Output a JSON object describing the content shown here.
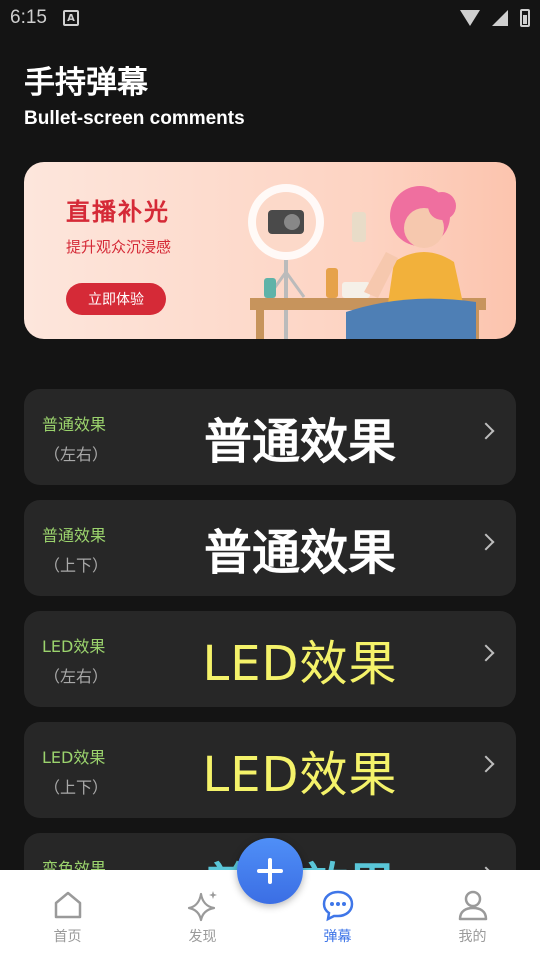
{
  "status_bar": {
    "time": "6:15"
  },
  "header": {
    "title": "手持弹幕",
    "subtitle": "Bullet-screen comments"
  },
  "banner": {
    "title": "直播补光",
    "subtitle": "提升观众沉浸感",
    "button": "立即体验"
  },
  "cards": [
    {
      "label": "普通效果",
      "sublabel": "（左右）",
      "preview": "普通效果"
    },
    {
      "label": "普通效果",
      "sublabel": "（上下）",
      "preview": "普通效果"
    },
    {
      "label": "LED效果",
      "sublabel": "（左右）",
      "preview": "LED效果"
    },
    {
      "label": "LED效果",
      "sublabel": "（上下）",
      "preview": "LED效果"
    },
    {
      "label": "变色效果",
      "sublabel": "",
      "preview": "普通效果"
    }
  ],
  "tabs": [
    {
      "label": "首页",
      "icon": "home-icon"
    },
    {
      "label": "发现",
      "icon": "sparkle-icon"
    },
    {
      "label": "弹幕",
      "icon": "chat-bubble-icon"
    },
    {
      "label": "我的",
      "icon": "user-icon"
    }
  ],
  "colors": {
    "accent": "#3f76e8",
    "card_label": "#9bd36d",
    "led": "#f4f26a",
    "banner_red": "#d52a37"
  }
}
